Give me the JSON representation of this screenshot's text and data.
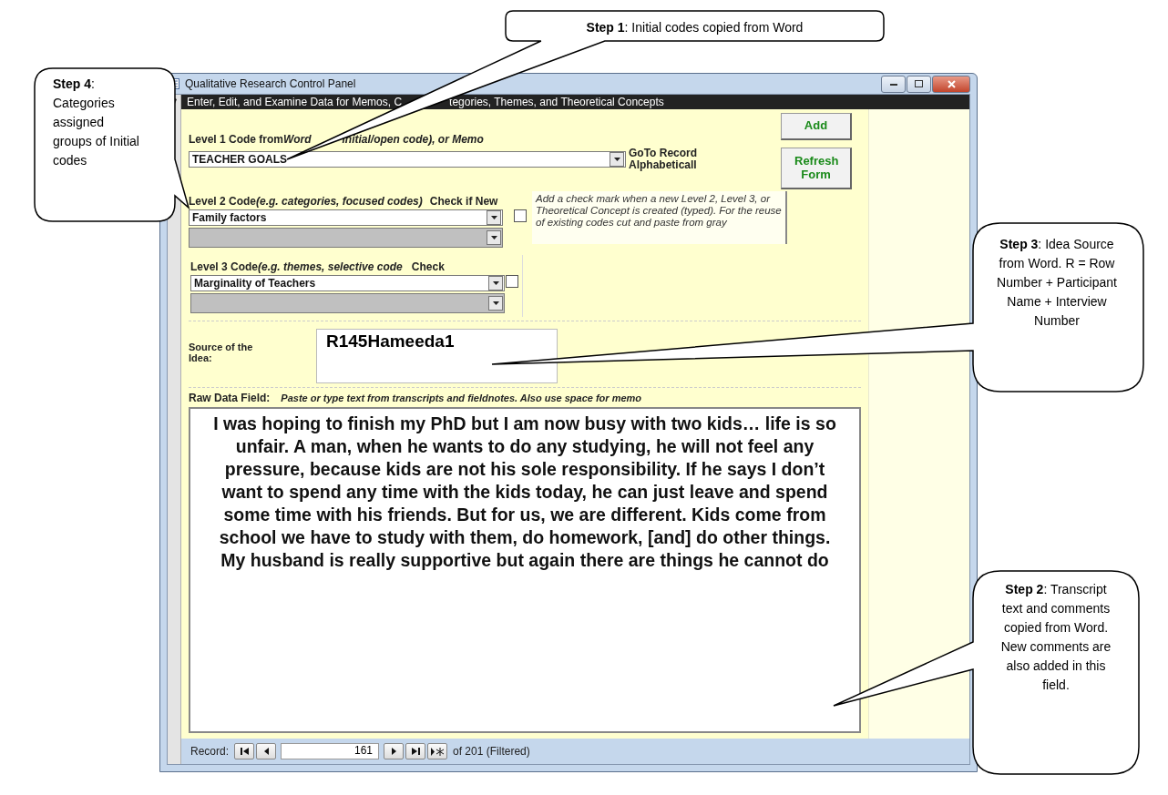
{
  "window": {
    "title": "Qualitative Research Control Panel"
  },
  "form_header": [
    "Enter, Edit, and Examine Data for Memos, C",
    "tegories, Themes, and Theoretical Concepts"
  ],
  "buttons": [
    {
      "label": "Add"
    },
    {
      "label": "Refresh Form"
    }
  ],
  "level1": {
    "label": "Level 1 Code from",
    "label_word": "Word",
    "hint": "initial/open code), or Memo",
    "value": "TEACHER GOALS",
    "goto_label": "GoTo Record Alphabeticall"
  },
  "level2": {
    "label": "Level 2 Code",
    "hint": "(e.g. categories, focused codes)",
    "check_label": "Check if New",
    "checked": false,
    "value": "Family factors",
    "note": "Add a check mark when a new Level 2, Level 3, or Theoretical Concept is created (typed).  For the reuse of existing codes cut and paste from gray"
  },
  "level3": {
    "label": "Level 3 Code",
    "hint": "(e.g. themes, selective code",
    "check_label": "Check",
    "checked": false,
    "value": "Marginality of Teachers"
  },
  "source": {
    "label": "Source of the Idea:",
    "value": "R145Hameeda1"
  },
  "raw_data": {
    "label": "Raw Data  Field:",
    "hint": "Paste or type text from transcripts and fieldnotes. Also use space for memo",
    "value": "I was hoping to finish my PhD but I am now busy with two kids… life is so unfair. A man, when he wants to do any studying, he will not feel any pressure, because kids are not his sole responsibility. If he says I don’t want to spend any time with the kids today, he can just leave and spend some time with his friends. But for us, we are different. Kids come from school we have to study with them, do homework, [and] do other things. My husband is really supportive but again there are things he cannot do"
  },
  "record_nav": {
    "label": "Record:",
    "current": "161",
    "total": "of 201 (Filtered)"
  },
  "callouts": [
    {
      "kind": "step1",
      "text": "**Step 1**: Initial codes copied from Word"
    },
    {
      "kind": "step4",
      "text": "**Step 4**: Categories assigned groups of Initial codes"
    },
    {
      "kind": "step3",
      "text": "**Step 3**: Idea Source from Word. R = Row Number + Participant Name + Interview Number"
    },
    {
      "kind": "step2",
      "text": "**Step 2**: Transcript text and comments copied from Word. New comments are also added in this field."
    }
  ]
}
